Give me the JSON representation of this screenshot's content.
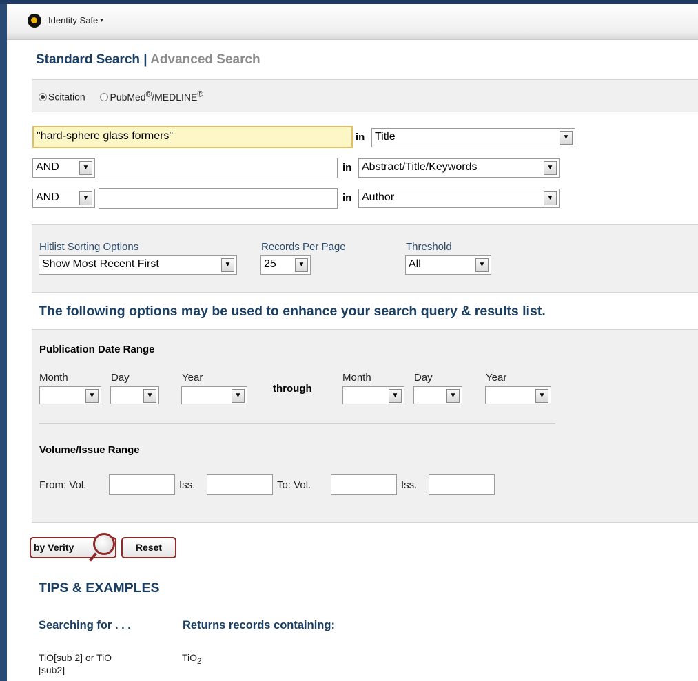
{
  "toolbar": {
    "identity_safe_label": "Identity Safe",
    "caret": "▾"
  },
  "tabs": {
    "standard": "Standard Search",
    "separator": "|",
    "advanced": "Advanced Search"
  },
  "databases": {
    "scitation": "Scitation",
    "pubmed": "PubMed",
    "reg": "®",
    "medline": "/MEDLINE",
    "selected": "Scitation"
  },
  "search_rows": [
    {
      "operator": "",
      "value": "\"hard-sphere glass formers\"",
      "in_label": "in",
      "field": "Title"
    },
    {
      "operator": "AND",
      "value": "",
      "in_label": "in",
      "field": "Abstract/Title/Keywords"
    },
    {
      "operator": "AND",
      "value": "",
      "in_label": "in",
      "field": "Author"
    }
  ],
  "options": {
    "sorting_label": "Hitlist Sorting Options",
    "sorting_value": "Show Most Recent First",
    "records_label": "Records Per Page",
    "records_value": "25",
    "threshold_label": "Threshold",
    "threshold_value": "All"
  },
  "enhance_heading": "The following options may be used to enhance your search query & results list.",
  "date_range": {
    "heading": "Publication Date Range",
    "month": "Month",
    "day": "Day",
    "year": "Year",
    "through": "through"
  },
  "volume_range": {
    "heading": "Volume/Issue Range",
    "from_vol": "From: Vol.",
    "iss": "Iss.",
    "to_vol": "To: Vol."
  },
  "buttons": {
    "search": "by Verity",
    "reset": "Reset"
  },
  "tips": {
    "heading": "TIPS & EXAMPLES",
    "col1": "Searching for . . .",
    "col2": "Returns records containing:",
    "rows": [
      {
        "query": "TiO[sub 2] or TiO [sub2]",
        "result_base": "TiO",
        "result_sub": "2"
      }
    ]
  },
  "colors": {
    "heading_blue": "#1a3f62",
    "panel_gray": "#f0f0f0",
    "highlight_field": "#fdf6c6",
    "button_border": "#8e2a2a",
    "left_bar": "#2a4a74"
  }
}
